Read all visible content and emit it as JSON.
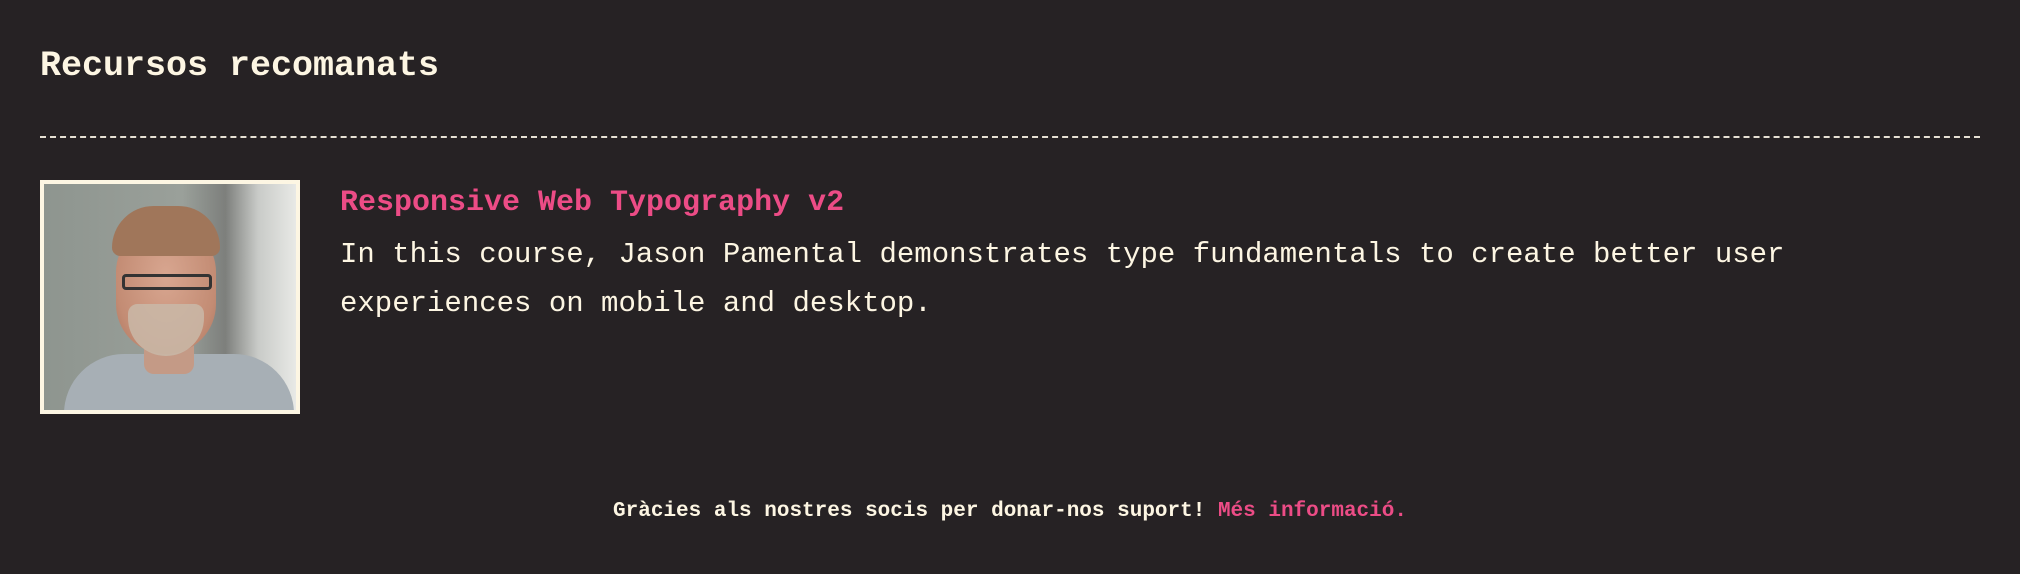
{
  "section": {
    "heading": "Recursos recomanats"
  },
  "resources": [
    {
      "title": "Responsive Web Typography v2",
      "description": "In this course, Jason Pamental demonstrates type fundamentals to create better user experiences on mobile and desktop."
    }
  ],
  "footer": {
    "text": "Gràcies als nostres socis per donar-nos suport!",
    "link": "Més informació."
  },
  "colors": {
    "background": "#262224",
    "text": "#fdf6e3",
    "accent": "#ec4c86"
  }
}
